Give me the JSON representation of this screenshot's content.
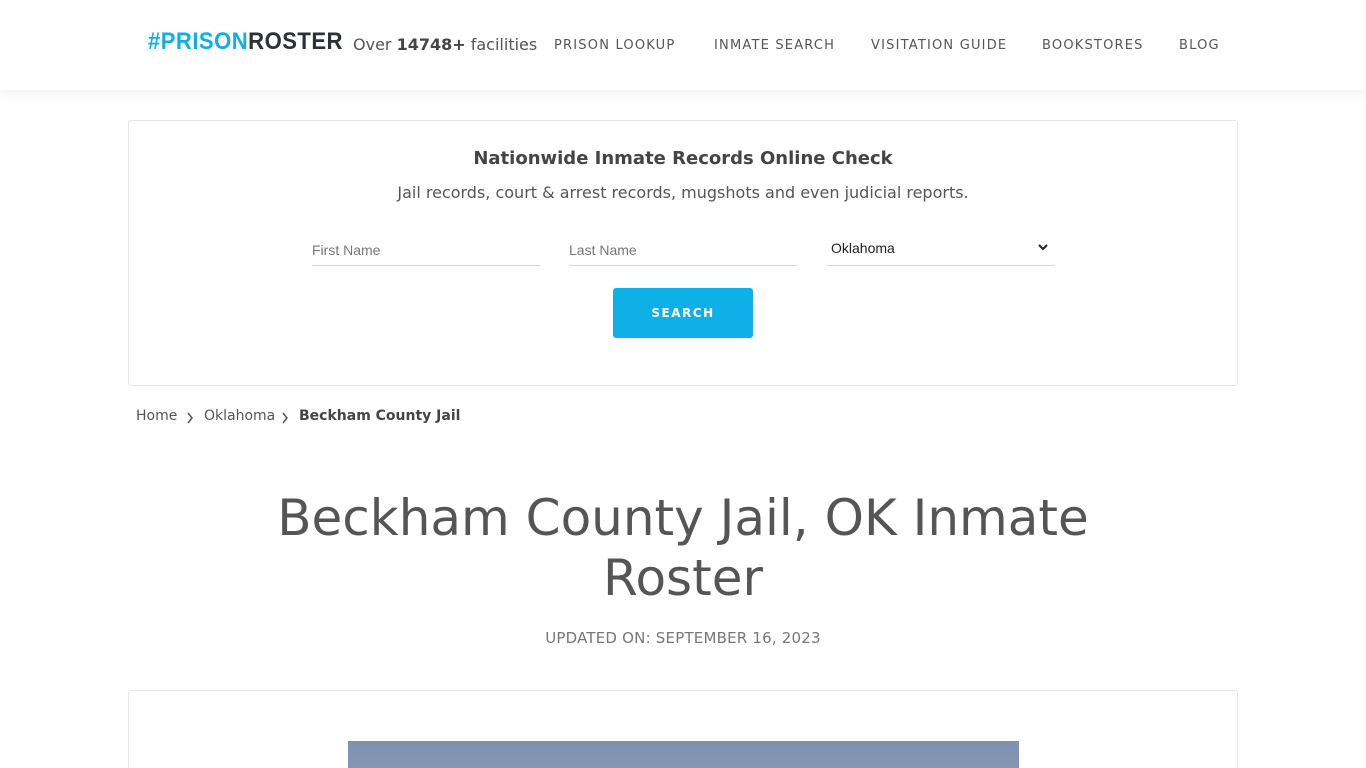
{
  "header": {
    "logo_part1": "#PRISON",
    "logo_part2": "ROSTER",
    "facilities_prefix": "Over ",
    "facilities_count": "14748+",
    "facilities_suffix": " facilities",
    "nav": [
      "PRISON LOOKUP",
      "INMATE SEARCH",
      "VISITATION GUIDE",
      "BOOKSTORES",
      "BLOG"
    ]
  },
  "search": {
    "title": "Nationwide Inmate Records Online Check",
    "subtitle": "Jail records, court & arrest records, mugshots and even judicial reports.",
    "first_name_placeholder": "First Name",
    "last_name_placeholder": "Last Name",
    "state_selected": "Oklahoma",
    "button_label": "SEARCH"
  },
  "breadcrumb": {
    "home": "Home",
    "state": "Oklahoma",
    "current": "Beckham County Jail"
  },
  "page": {
    "title": "Beckham County Jail, OK Inmate Roster",
    "updated": "UPDATED ON: SEPTEMBER 16, 2023"
  },
  "colors": {
    "accent": "#0fb0e8",
    "logo_dark": "#2d3038"
  },
  "icons": [
    "chevron-down-icon",
    "chevron-right-icon"
  ]
}
